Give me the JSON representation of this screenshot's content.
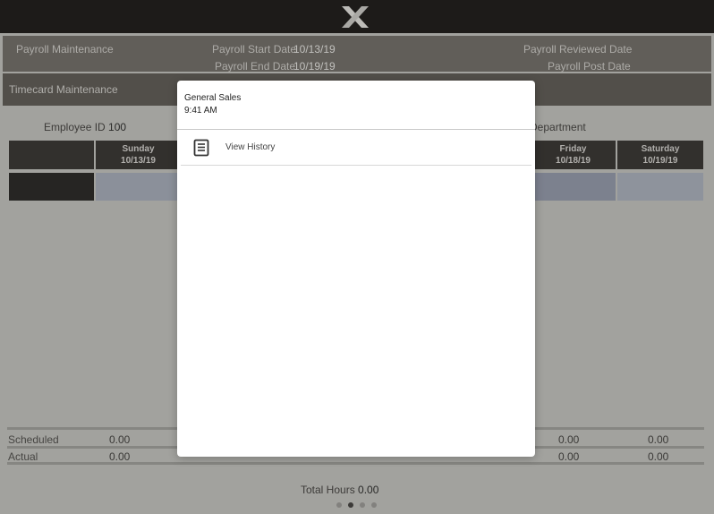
{
  "header": {
    "logo_icon": "x-logo-icon"
  },
  "payroll": {
    "title": "Payroll Maintenance",
    "start_label": "Payroll Start Date",
    "start_value": "10/13/19",
    "end_label": "Payroll End Date",
    "end_value": "10/19/19",
    "reviewed_label": "Payroll Reviewed Date",
    "post_label": "Payroll Post Date"
  },
  "timecard": {
    "title": "Timecard Maintenance",
    "employee_label": "Employee ID",
    "employee_value": "100",
    "department_label": "Department"
  },
  "days": [
    {
      "day": "Sunday",
      "date": "10/13/19"
    },
    {
      "day": "Friday",
      "date": "10/18/19"
    },
    {
      "day": "Saturday",
      "date": "10/19/19"
    }
  ],
  "summary": {
    "scheduled_label": "Scheduled",
    "actual_label": "Actual",
    "scheduled_values": [
      "0.00",
      "0.00",
      "0.00"
    ],
    "actual_values": [
      "0.00",
      "0.00",
      "0.00"
    ]
  },
  "footer": {
    "total_label": "Total Hours",
    "total_value": "0.00",
    "pager_count": 4,
    "pager_active": 2
  },
  "popover": {
    "title": "General Sales",
    "time": "9:41 AM",
    "items": [
      {
        "label": "View History",
        "icon": "document-list-icon"
      }
    ]
  },
  "colors": {
    "topbar": "#1d1b19",
    "payroll_bar": "#6f6b66",
    "timecard_bar": "#5a5651",
    "grid_header": "#2e2b29",
    "cell_blue": "#a9b0c0"
  }
}
